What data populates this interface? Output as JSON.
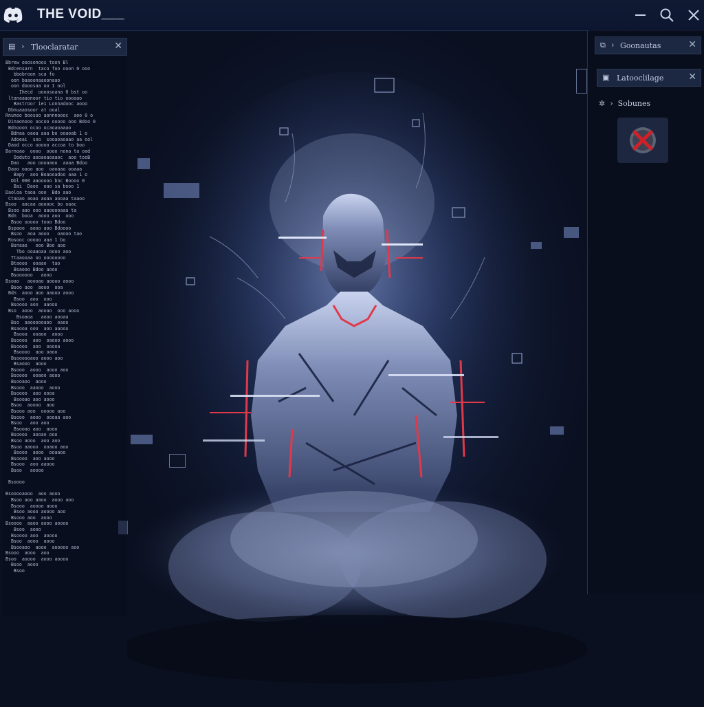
{
  "app": {
    "title": "THE VOID___",
    "logo_icon": "discord-logo-icon"
  },
  "window_controls": {
    "minimize_icon": "minimize-icon",
    "search_icon": "search-icon",
    "close_icon": "close-icon"
  },
  "left_panel": {
    "header": {
      "icon": "console-icon",
      "label": "Tlooclaratar"
    },
    "log_lines": [
      "Bbrew ooosonoos toon Bl",
      " Bdcensarn  taco foo ooon 0 ooo",
      "   bbobroon sca fo",
      "  oon baaoonaaoonaao",
      "  oon dooosaa oo 1 ool",
      "     Ihecd  oooosoana 0 bst oo",
      " ltanaaaonoor tio tio oooaao",
      "   Bastroor ie1 Lonnadooc aooo",
      " Dbnuaaosoor at ooal",
      "Rnunoo boosoo aonnnoooc  aoo 0 o",
      " Dinaonooo oocoo ooooo ooo Bdoo 0",
      " Bdnooon ocoo ocaoaoaaao",
      "  Bdnaa oaoa aaa bo ooaoab 1 o",
      "  Adoeai  soo  sooaoaoaao aa ool",
      " Daod occo ooooo accoa to boo",
      "Barnoao  oooo  oooo nona ta oad",
      "   Ooduto aooaoaoaaoc  aoo tooB",
      "  Dao   aoo oooaaoo  aaaa Bdoo",
      " Daoo oaoo aoo  oaoaao ooaaa",
      "   Bapy  aoo Boaooadoo aaa 1 o",
      "  Dbl 000 aaooooo bnc Boooo 0",
      "   Bai  Daoe  oao sa booo 1",
      "Daoloa taoa ooo  Bdo aao",
      " Ctaoao aoao aoaa aooaa taaoo",
      "Bsoo  aacaa aooooc bo oaac",
      " Bsoo aao ooo aaooooaaa ta",
      " Bdn  booa  aooo aoo  ooo",
      "  Bsoo ooooo tooo Bdoo",
      " Bspaoo  aooo aoo Bdoooo",
      "  Bsoo  aoa aooo   oaooo tao",
      " Rosooc ooooo aaa 1 bo",
      "  Bsnaao   ooo Boo aoo",
      "    Tbo ooaaoaa oooo aoo",
      "  Ttaaooaa oo oooooooo",
      "  Btaooo  ooaao  tao",
      "   Bsaooo Bdoo aooo",
      "  Bsoooooo   aooo",
      "Bsoao   aoooao aoooo aooo",
      "  Bsoo aoo  aooo  ooa",
      " Bdn  aooo aoo aaooo aooo",
      "   Bsoo  aoo  ooo",
      "  Bsoooo aoo  aaooo",
      " Bso  aooo  aooao  ooo aooo",
      "    Bsoaoa   aooo aooaa",
      "  Bso  aaoooooaoo  oaoo",
      "  Bsaooa ooo  aoo aaooo",
      "   Bsooa  ooaoo  aooo",
      "  Bsoooo  aoo  oaooo aooo",
      "  Bsoooo  aoo  ooooa",
      "   Bsoooo  aoo oaoo",
      "  Bsoooooaoo aooo aoo",
      "   Bsaooo  aooo",
      "  Bsooo  aooo  aooo aoo",
      "  Bsoooo  ooaoo aooo",
      "  Bsooaoo  aooo",
      "  Bsooo  aaooo  aooo",
      "  Bsoooo  aoo oooa",
      "   Bsooao aoo aooo",
      "  Bsoo  aoooo  aoo",
      "  Bsooo aoo  ooooo aoo",
      "  Bsooo  aooo  oooaa aoo",
      "  Bsoo   aoo aoo",
      "   Bsooao aoo  aooo",
      "  Bsoooo  aooao ooo",
      "  Bsoo aooo  aoo aoo",
      "  Bsoo aaooo  ooaoo aoo",
      "   Bsooo  aooo  ooaaoo",
      "  Bsoooo  aoo aooo",
      "  Bsooo  aoo aaooo",
      "  Bsoo   aoooo",
      "",
      " Bsoooo",
      "",
      "Bsooooaooo  aoo aooo",
      "  Bsoo aoo aaoo  aooo aoo",
      "  Bsooo  aoooo aooo",
      "   Bsoo aooo aoooo aoo",
      "  Bsooo aoo  aooo",
      "Bsoooo  aaoo aooo aoooo",
      "   Bsoo  aooo",
      "  Bsoooo aoo  aoooo",
      "  Bsoo  aooo  aooo",
      "  Bsooaoo  aooo  aooooo aoo",
      "Bsooo  aooo  aoo",
      "Bsoo  aoooo  aooo aoooo",
      "  Bsoo  aooo",
      "   Bsoo"
    ]
  },
  "right_panel": {
    "panel1": {
      "icon": "folder-icon",
      "label": "Goonautas"
    },
    "panel2": {
      "icon": "image-icon",
      "label": "Latooclilage"
    },
    "section": {
      "icon": "settings-icon",
      "label": "Sobunes"
    },
    "error_tile": {
      "icon": "error-x-icon",
      "accent": "#d0202a"
    }
  },
  "colors": {
    "background": "#0b1122",
    "panel": "#1c2742",
    "text": "#c9d2e6",
    "glitch_red": "#e0394a"
  }
}
